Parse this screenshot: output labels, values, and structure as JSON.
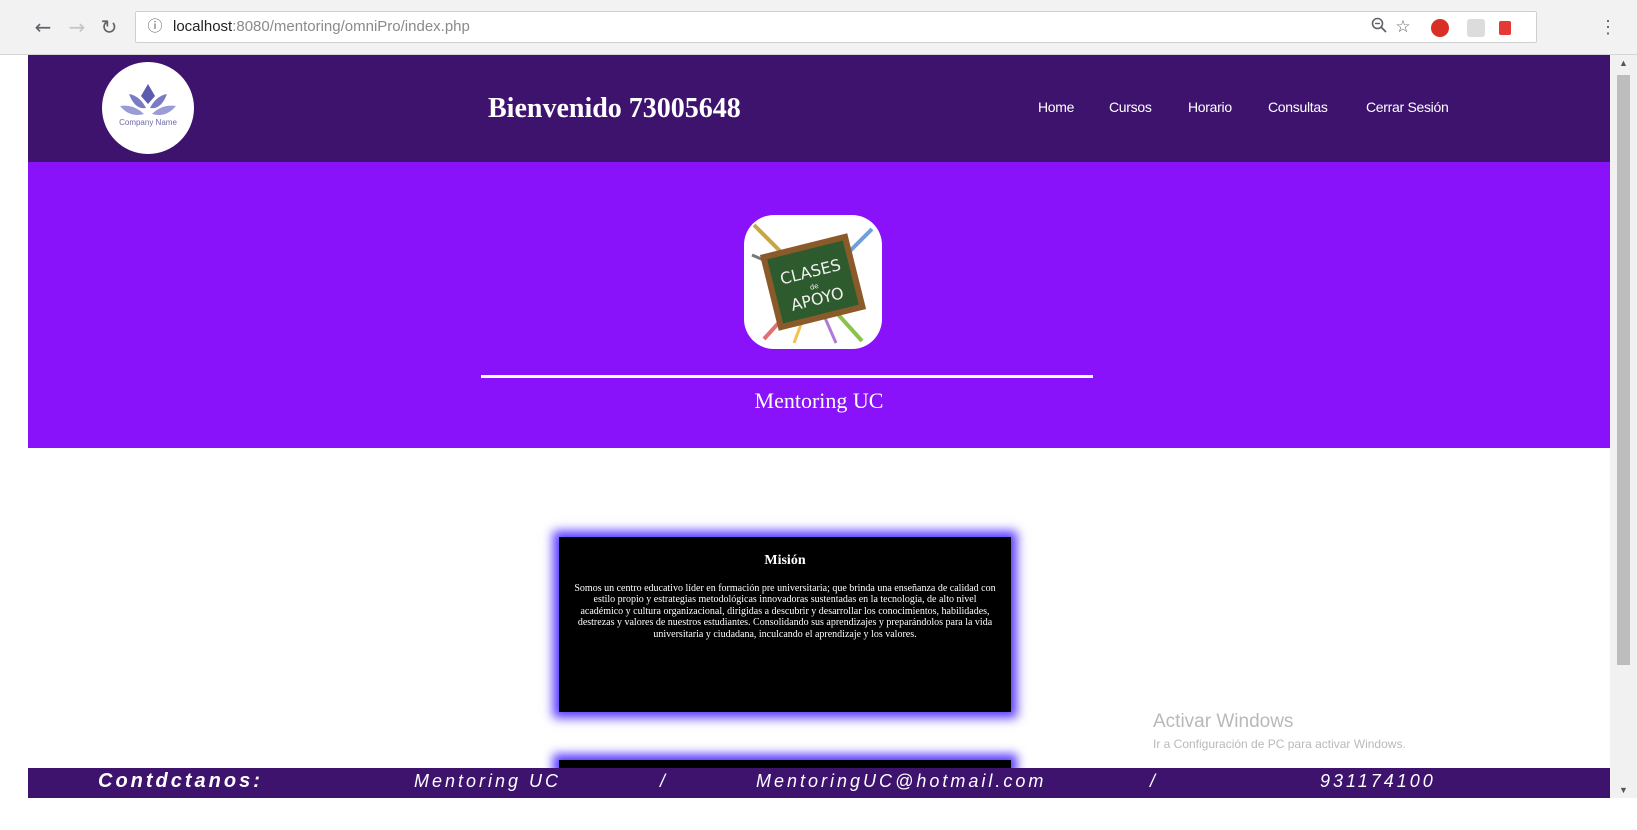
{
  "browser": {
    "url_host": "localhost",
    "url_path": ":8080/mentoring/omniPro/index.php",
    "icons": {
      "back": "arrow-left-icon",
      "forward": "arrow-right-icon",
      "reload": "reload-icon",
      "info": "info-icon",
      "zoom": "zoom-icon",
      "bookmark": "star-icon",
      "menu": "more-vert-icon"
    },
    "colors": {
      "ext_red": "#d93025",
      "ext_gray": "#bdbdbd",
      "ext_red2": "#e53935"
    }
  },
  "header": {
    "logo_text": "Company Name",
    "welcome": "Bienvenido 73005648",
    "menu": [
      "Home",
      "Cursos",
      "Horario",
      "Consultas",
      "Cerrar Sesión"
    ]
  },
  "hero": {
    "image_text_1": "CLASES",
    "image_text_2": "de",
    "image_text_3": "APOYO",
    "title": "Mentoring UC"
  },
  "mision": {
    "title": "Misión",
    "text": "Somos un centro educativo líder en formación pre universitaria; que brinda una enseñanza de calidad con estilo propio y estrategias metodológicas innovadoras sustentadas en la tecnología, de alto nivel académico y cultura organizacional, dirigidas a descubrir y desarrollar los conocimientos, habilidades, destrezas y valores de nuestros estudiantes. Consolidando sus aprendizajes y preparándolos para la vida universitaria y ciudadana, inculcando el aprendizaje y los valores."
  },
  "watermark": {
    "line1": "Activar Windows",
    "line2": "Ir a Configuración de PC para activar Windows."
  },
  "footer": {
    "contact": "Contdctanos:",
    "name": "Mentoring UC",
    "sep": "/",
    "email": "MentoringUC@hotmail.com",
    "phone": "931174100"
  },
  "colors": {
    "header_bg": "#3d136e",
    "hero_bg": "#8a12fb",
    "card_bg": "#000000",
    "card_glow": "#5b3cff"
  }
}
